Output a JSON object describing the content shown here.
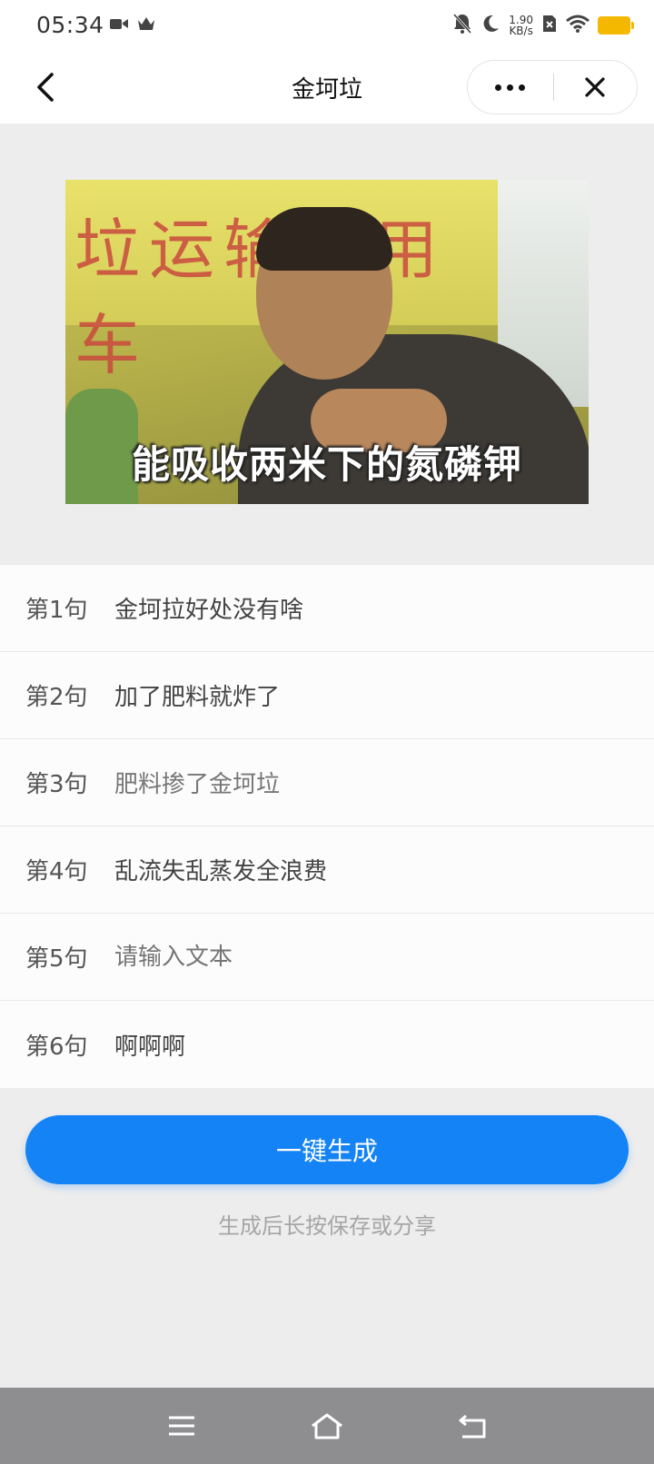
{
  "status": {
    "time": "05:34",
    "net_speed_value": "1.90",
    "net_speed_unit": "KB/s"
  },
  "titlebar": {
    "title": "金坷垃"
  },
  "meme": {
    "banner_text": "垃运输专用车",
    "caption": "能吸收两米下的氮磷钾"
  },
  "sentences": [
    {
      "label": "第1句",
      "value": "金坷拉好处没有啥"
    },
    {
      "label": "第2句",
      "value": "加了肥料就炸了"
    },
    {
      "label": "第3句",
      "value": "肥料掺了金坷垃"
    },
    {
      "label": "第4句",
      "value": "乱流失乱蒸发全浪费"
    },
    {
      "label": "第5句",
      "value": "",
      "placeholder": "请输入文本"
    },
    {
      "label": "第6句",
      "value": "啊啊啊"
    }
  ],
  "generate_button": "一键生成",
  "hint": "生成后长按保存或分享",
  "colors": {
    "accent": "#1483f5",
    "battery": "#f5b800",
    "navbar": "#8e8e91"
  },
  "icons": {
    "back": "chevron-left-icon",
    "more": "more-dots-icon",
    "close": "close-icon",
    "nav_menu": "menu-icon",
    "nav_home": "home-icon",
    "nav_back": "back-arrow-icon"
  }
}
